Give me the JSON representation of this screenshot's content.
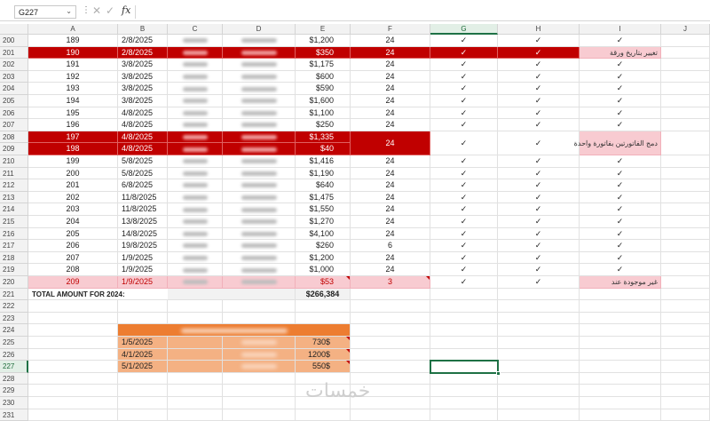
{
  "formula_bar": {
    "name_box": "G227",
    "name_box_dropdown_icon": "chevron-down-icon",
    "fx_label": "fx",
    "formula_value": ""
  },
  "columns": [
    "A",
    "B",
    "C",
    "D",
    "E",
    "F",
    "G",
    "H",
    "I",
    "J"
  ],
  "rows": [
    {
      "num": "200",
      "A": "189",
      "B": "2/8/2025",
      "E": "$1,200",
      "F": "24",
      "G": "✓",
      "H": "✓",
      "I": "✓",
      "style": "normal"
    },
    {
      "num": "201",
      "A": "190",
      "B": "2/8/2025",
      "E": "$350",
      "F": "24",
      "G": "✓",
      "H": "✓",
      "I": "تغيير بتاريخ ورقة",
      "style": "red"
    },
    {
      "num": "202",
      "A": "191",
      "B": "3/8/2025",
      "E": "$1,175",
      "F": "24",
      "G": "✓",
      "H": "✓",
      "I": "✓",
      "style": "normal"
    },
    {
      "num": "203",
      "A": "192",
      "B": "3/8/2025",
      "E": "$600",
      "F": "24",
      "G": "✓",
      "H": "✓",
      "I": "✓",
      "style": "normal"
    },
    {
      "num": "204",
      "A": "193",
      "B": "3/8/2025",
      "E": "$590",
      "F": "24",
      "G": "✓",
      "H": "✓",
      "I": "✓",
      "style": "normal"
    },
    {
      "num": "205",
      "A": "194",
      "B": "3/8/2025",
      "E": "$1,600",
      "F": "24",
      "G": "✓",
      "H": "✓",
      "I": "✓",
      "style": "normal"
    },
    {
      "num": "206",
      "A": "195",
      "B": "4/8/2025",
      "E": "$1,100",
      "F": "24",
      "G": "✓",
      "H": "✓",
      "I": "✓",
      "style": "normal"
    },
    {
      "num": "207",
      "A": "196",
      "B": "4/8/2025",
      "E": "$250",
      "F": "24",
      "G": "✓",
      "H": "✓",
      "I": "✓",
      "style": "normal"
    },
    {
      "num": "208",
      "A": "197",
      "B": "4/8/2025",
      "E": "$1,335",
      "F": "24",
      "G": "✓",
      "H": "✓",
      "I": "دمج الفاتورتين بفاتورة واحدة",
      "style": "red-merged-top"
    },
    {
      "num": "209",
      "A": "198",
      "B": "4/8/2025",
      "E": "$40",
      "F": "",
      "G": "",
      "H": "",
      "I": "",
      "style": "red-merged-bottom"
    },
    {
      "num": "210",
      "A": "199",
      "B": "5/8/2025",
      "E": "$1,416",
      "F": "24",
      "G": "✓",
      "H": "✓",
      "I": "✓",
      "style": "normal"
    },
    {
      "num": "211",
      "A": "200",
      "B": "5/8/2025",
      "E": "$1,190",
      "F": "24",
      "G": "✓",
      "H": "✓",
      "I": "✓",
      "style": "normal"
    },
    {
      "num": "212",
      "A": "201",
      "B": "6/8/2025",
      "E": "$640",
      "F": "24",
      "G": "✓",
      "H": "✓",
      "I": "✓",
      "style": "normal"
    },
    {
      "num": "213",
      "A": "202",
      "B": "11/8/2025",
      "E": "$1,475",
      "F": "24",
      "G": "✓",
      "H": "✓",
      "I": "✓",
      "style": "normal"
    },
    {
      "num": "214",
      "A": "203",
      "B": "11/8/2025",
      "E": "$1,550",
      "F": "24",
      "G": "✓",
      "H": "✓",
      "I": "✓",
      "style": "normal"
    },
    {
      "num": "215",
      "A": "204",
      "B": "13/8/2025",
      "E": "$1,270",
      "F": "24",
      "G": "✓",
      "H": "✓",
      "I": "✓",
      "style": "normal"
    },
    {
      "num": "216",
      "A": "205",
      "B": "14/8/2025",
      "E": "$4,100",
      "F": "24",
      "G": "✓",
      "H": "✓",
      "I": "✓",
      "style": "normal"
    },
    {
      "num": "217",
      "A": "206",
      "B": "19/8/2025",
      "E": "$260",
      "F": "6",
      "G": "✓",
      "H": "✓",
      "I": "✓",
      "style": "normal"
    },
    {
      "num": "218",
      "A": "207",
      "B": "1/9/2025",
      "E": "$1,200",
      "F": "24",
      "G": "✓",
      "H": "✓",
      "I": "✓",
      "style": "normal"
    },
    {
      "num": "219",
      "A": "208",
      "B": "1/9/2025",
      "E": "$1,000",
      "F": "24",
      "G": "✓",
      "H": "✓",
      "I": "✓",
      "style": "normal"
    },
    {
      "num": "220",
      "A": "209",
      "B": "1/9/2025",
      "E": "$53",
      "F": "3",
      "G": "✓",
      "H": "✓",
      "I": "غير موجودة عند",
      "style": "pink"
    },
    {
      "num": "221",
      "A": "TOTAL AMOUNT FOR 2024:",
      "E": "$266,384",
      "style": "total"
    },
    {
      "num": "222",
      "style": "empty"
    },
    {
      "num": "223",
      "style": "empty"
    },
    {
      "num": "224",
      "style": "orange-header"
    },
    {
      "num": "225",
      "B": "1/5/2025",
      "E": "730$",
      "style": "orange"
    },
    {
      "num": "226",
      "B": "4/1/2025",
      "E": "1200$",
      "style": "orange"
    },
    {
      "num": "227",
      "B": "5/1/2025",
      "E": "550$",
      "style": "orange"
    },
    {
      "num": "228",
      "style": "empty"
    },
    {
      "num": "229",
      "style": "empty"
    },
    {
      "num": "230",
      "style": "empty"
    },
    {
      "num": "231",
      "style": "empty"
    }
  ],
  "watermark": "خمسات",
  "colors": {
    "header_bg": "#f2f2f2",
    "red_row": "#c00000",
    "pink_row": "#f8cbd1",
    "orange": "#ed7d31",
    "light_orange": "#f4b183",
    "selection": "#1e7145"
  }
}
